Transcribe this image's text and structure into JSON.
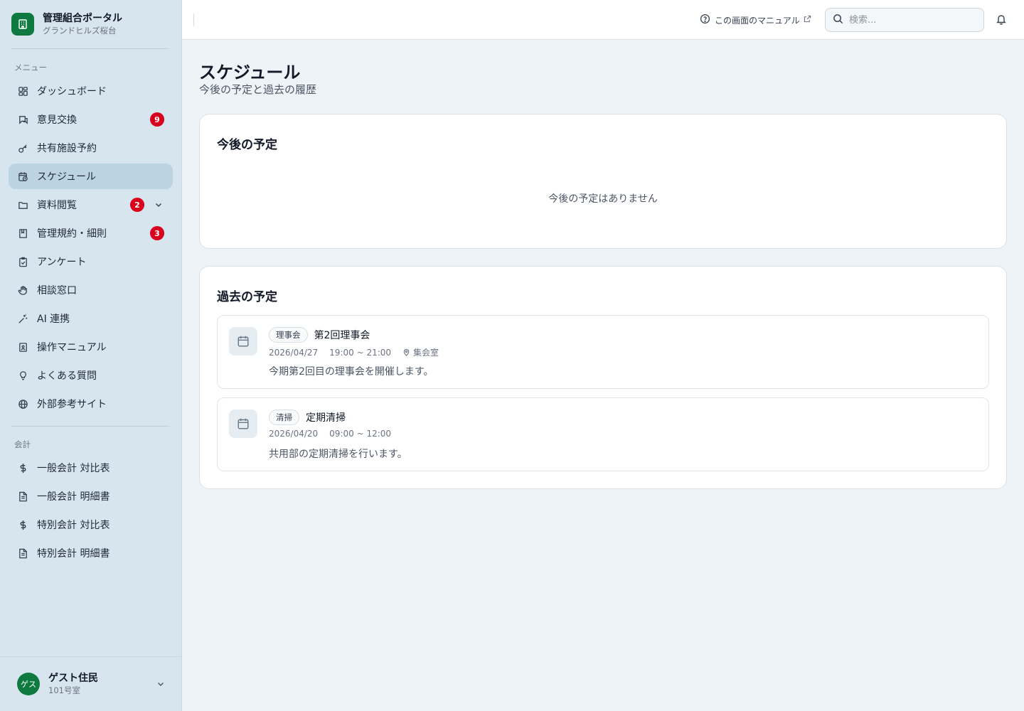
{
  "brand": {
    "title": "管理組合ポータル",
    "subtitle": "グランドヒルズ桜台"
  },
  "sidebar": {
    "menu_label": "メニュー",
    "items": [
      {
        "label": "ダッシュボード",
        "icon": "dashboard-icon"
      },
      {
        "label": "意見交換",
        "icon": "chat-icon",
        "badge": "9"
      },
      {
        "label": "共有施設予約",
        "icon": "key-icon"
      },
      {
        "label": "スケジュール",
        "icon": "calendar-clock-icon",
        "active": true
      },
      {
        "label": "資料閲覧",
        "icon": "folder-icon",
        "badge": "2"
      },
      {
        "label": "管理規約・細則",
        "icon": "book-icon",
        "badge": "3"
      },
      {
        "label": "アンケート",
        "icon": "clipboard-check-icon"
      },
      {
        "label": "相談窓口",
        "icon": "hand-icon"
      },
      {
        "label": "AI 連携",
        "icon": "sparkle-icon"
      },
      {
        "label": "操作マニュアル",
        "icon": "manual-icon"
      },
      {
        "label": "よくある質問",
        "icon": "lightbulb-icon"
      },
      {
        "label": "外部参考サイト",
        "icon": "globe-icon"
      }
    ],
    "accounting_label": "会計",
    "accounting_items": [
      {
        "label": "一般会計 対比表",
        "icon": "dollar-icon"
      },
      {
        "label": "一般会計 明細書",
        "icon": "document-icon"
      },
      {
        "label": "特別会計 対比表",
        "icon": "dollar-icon"
      },
      {
        "label": "特別会計 明細書",
        "icon": "document-icon"
      }
    ]
  },
  "user": {
    "avatar": "ゲス",
    "name": "ゲスト住民",
    "room": "101号室"
  },
  "header": {
    "manual_link": "この画面のマニュアル",
    "search_placeholder": "検索..."
  },
  "page": {
    "title": "スケジュール",
    "subtitle": "今後の予定と過去の履歴"
  },
  "upcoming": {
    "title": "今後の予定",
    "empty": "今後の予定はありません"
  },
  "past": {
    "title": "過去の予定",
    "events": [
      {
        "tag": "理事会",
        "title": "第2回理事会",
        "date": "2026/04/27",
        "time": "19:00 ~ 21:00",
        "location": "集会室",
        "description": "今期第2回目の理事会を開催します。"
      },
      {
        "tag": "清掃",
        "title": "定期清掃",
        "date": "2026/04/20",
        "time": "09:00 ~ 12:00",
        "location": "",
        "description": "共用部の定期清掃を行います。"
      }
    ]
  },
  "colors": {
    "brand": "#0e7a3f",
    "badge": "#d8001c",
    "sidebar_bg": "#d7e5ee",
    "active_bg": "#bcd3e2"
  }
}
